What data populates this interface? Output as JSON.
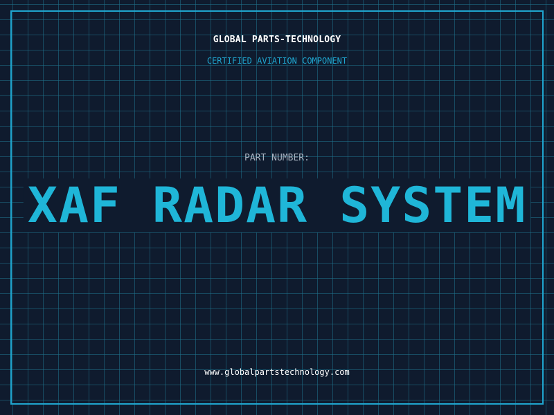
{
  "header": {
    "company": "GLOBAL PARTS-TECHNOLOGY",
    "tagline": "CERTIFIED AVIATION COMPONENT"
  },
  "part": {
    "label": "PART NUMBER:",
    "name": "XAF RADAR SYSTEM"
  },
  "footer": {
    "url": "www.globalpartstechnology.com"
  },
  "colors": {
    "background": "#0f1b2e",
    "accent": "#1fa6cf",
    "title": "#1fb6d8",
    "grid": "#1e738c"
  }
}
